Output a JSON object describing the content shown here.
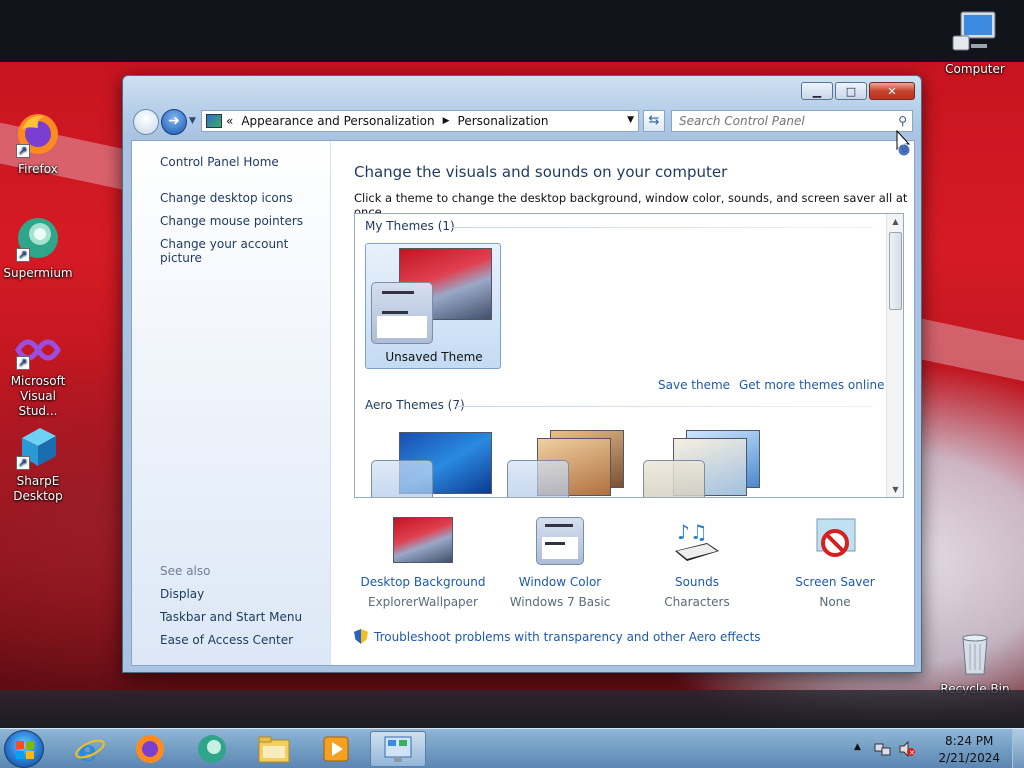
{
  "desktop": {
    "icons": [
      {
        "id": "computer",
        "label": "Computer"
      },
      {
        "id": "firefox",
        "label": "Firefox"
      },
      {
        "id": "supermium",
        "label": "Supermium"
      },
      {
        "id": "visual-studio",
        "label": "Microsoft Visual Stud..."
      },
      {
        "id": "sharpe",
        "label": "SharpE Desktop"
      },
      {
        "id": "recycle-bin",
        "label": "Recycle Bin"
      }
    ]
  },
  "window": {
    "address": {
      "prefix": "«",
      "crumbs": [
        "Appearance and Personalization",
        "Personalization"
      ]
    },
    "search_placeholder": "Search Control Panel",
    "left": {
      "home": "Control Panel Home",
      "links": [
        "Change desktop icons",
        "Change mouse pointers",
        "Change your account picture"
      ],
      "see_also_heading": "See also",
      "see_also": [
        "Display",
        "Taskbar and Start Menu",
        "Ease of Access Center"
      ]
    },
    "main": {
      "title": "Change the visuals and sounds on your computer",
      "subtitle": "Click a theme to change the desktop background, window color, sounds, and screen saver all at once.",
      "my_themes_heading": "My Themes (1)",
      "selected_theme": "Unsaved Theme",
      "save_theme": "Save theme",
      "get_more": "Get more themes online",
      "aero_heading": "Aero Themes (7)",
      "bottom": [
        {
          "label": "Desktop Background",
          "value": "ExplorerWallpaper"
        },
        {
          "label": "Window Color",
          "value": "Windows 7 Basic"
        },
        {
          "label": "Sounds",
          "value": "Characters"
        },
        {
          "label": "Screen Saver",
          "value": "None"
        }
      ],
      "troubleshoot": "Troubleshoot problems with transparency and other Aero effects"
    }
  },
  "taskbar": {
    "time": "8:24 PM",
    "date": "2/21/2024"
  },
  "colors": {
    "link": "#1e5aa8",
    "heading": "#1e3a5f"
  }
}
